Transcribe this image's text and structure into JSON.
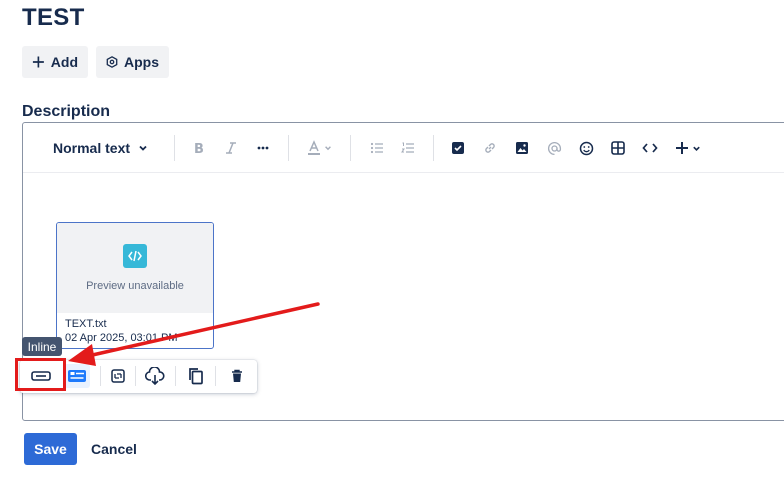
{
  "page": {
    "title": "TEST"
  },
  "actions": {
    "add_label": "Add",
    "apps_label": "Apps"
  },
  "description": {
    "label": "Description"
  },
  "toolbar": {
    "text_style": "Normal text",
    "icons": [
      "bold-icon",
      "italic-icon",
      "more-icon",
      "text-color-icon",
      "bullet-list-icon",
      "numbered-list-icon",
      "checkbox-icon",
      "link-icon",
      "image-icon",
      "mention-icon",
      "emoji-icon",
      "table-icon",
      "code-icon",
      "insert-icon"
    ]
  },
  "attachment": {
    "preview_text": "Preview unavailable",
    "file_name": "TEXT.txt",
    "date": "02 Apr 2025, 03:01 PM"
  },
  "media_toolbar": {
    "tooltip": "Inline",
    "icons": [
      "inline-icon",
      "card-icon",
      "embed-icon",
      "download-icon",
      "copy-icon",
      "delete-icon"
    ]
  },
  "footer": {
    "save_label": "Save",
    "cancel_label": "Cancel"
  },
  "colors": {
    "primary": "#2d6ad6",
    "annotation": "#e31b1b",
    "file_icon": "#36b8d8"
  }
}
